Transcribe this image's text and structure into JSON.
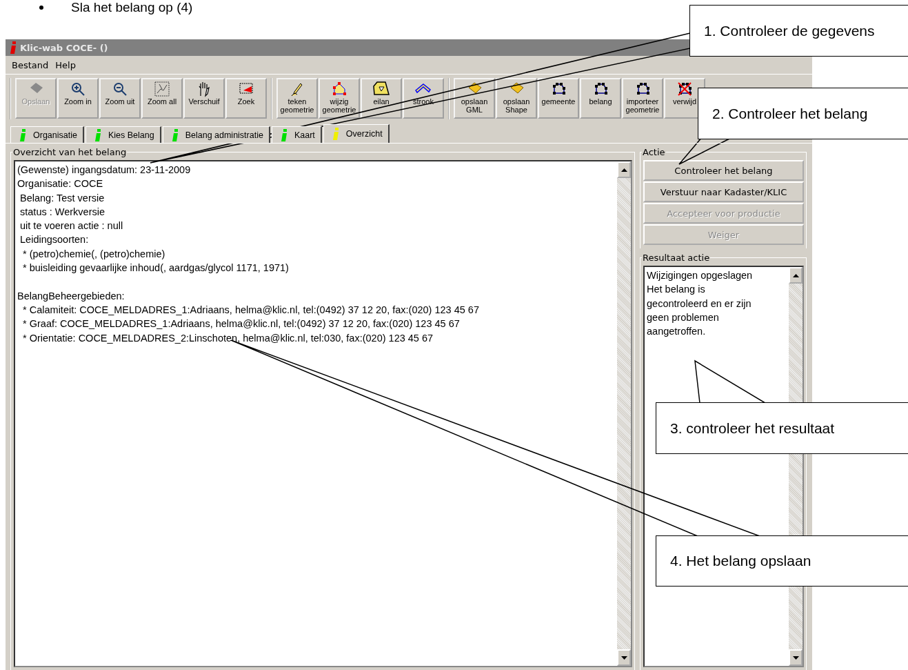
{
  "document": {
    "bullet": "Sla het belang op (4)"
  },
  "window": {
    "title": "Klic-wab COCE- ()"
  },
  "menu": [
    "Bestand",
    "Help"
  ],
  "toolbar_groups": [
    {
      "buttons": [
        {
          "lines": [
            "Opslaan"
          ],
          "disabled": true
        },
        {
          "lines": [
            "Zoom in"
          ],
          "disabled": false
        },
        {
          "lines": [
            "Zoom uit"
          ],
          "disabled": false
        },
        {
          "lines": [
            "Zoom all"
          ],
          "disabled": false
        },
        {
          "lines": [
            "Verschuif"
          ],
          "disabled": false
        },
        {
          "lines": [
            "Zoek"
          ],
          "disabled": false
        }
      ]
    },
    {
      "buttons": [
        {
          "lines": [
            "teken",
            "geometrie"
          ],
          "disabled": false
        },
        {
          "lines": [
            "wijzig",
            "geometrie"
          ],
          "disabled": false
        },
        {
          "lines": [
            "eilan"
          ],
          "disabled": false
        },
        {
          "lines": [
            "strook"
          ],
          "disabled": false
        }
      ]
    },
    {
      "buttons": [
        {
          "lines": [
            "opslaan",
            "GML"
          ],
          "disabled": false
        },
        {
          "lines": [
            "opslaan",
            "Shape"
          ],
          "disabled": false
        },
        {
          "lines": [
            "gemeente"
          ],
          "disabled": false
        },
        {
          "lines": [
            "belang"
          ],
          "disabled": false
        },
        {
          "lines": [
            "importeer",
            "geometrie"
          ],
          "disabled": false
        },
        {
          "lines": [
            "verwijd"
          ],
          "disabled": false
        }
      ]
    }
  ],
  "tabs": [
    {
      "label": "Organisatie",
      "selected": false
    },
    {
      "label": "Kies Belang",
      "selected": false
    },
    {
      "label": "Belang administratie",
      "selected": false
    },
    {
      "label": "Kaart",
      "selected": false
    },
    {
      "label": "Overzicht",
      "selected": true
    }
  ],
  "overview": {
    "title": "Overzicht van het belang",
    "paragraphs": [
      {
        "lines": [
          "(Gewenste) ingangsdatum: 23-11-2009",
          "Organisatie: COCE",
          " Belang: Test versie",
          " status : Werkversie",
          " uit te voeren actie : null",
          " Leidingsoorten:",
          "  * (petro)chemie(, (petro)chemie)",
          "  * buisleiding gevaarlijke inhoud(, aardgas/glycol 1171, 1971)"
        ]
      },
      {
        "lines": [
          "BelangBeheergebieden:",
          "  * Calamiteit: COCE_MELDADRES_1:Adriaans, helma@klic.nl, tel:(0492) 37 12 20, fax:(020) 123 45 67",
          "  * Graaf: COCE_MELDADRES_1:Adriaans, helma@klic.nl, tel:(0492) 37 12 20, fax:(020) 123 45 67",
          "  * Orientatie: COCE_MELDADRES_2:Linschoten, helma@klic.nl, tel:030, fax:(020) 123 45 67"
        ]
      }
    ]
  },
  "actions": {
    "title": "Actie",
    "buttons": [
      {
        "label": "Controleer het belang",
        "disabled": false
      },
      {
        "label": "Verstuur naar Kadaster/KLIC",
        "disabled": false
      },
      {
        "label": "Accepteer voor productie",
        "disabled": true
      },
      {
        "label": "Weiger",
        "disabled": true
      }
    ]
  },
  "result": {
    "title": "Resultaat actie",
    "lines": [
      "Wijzigingen opgeslagen",
      "Het belang is",
      "gecontroleerd en er zijn",
      "geen problemen",
      "aangetroffen."
    ]
  },
  "callouts": [
    {
      "text": "1. Controleer de gegevens"
    },
    {
      "text": "2. Controleer het belang"
    },
    {
      "text": "3. controleer het resultaat"
    },
    {
      "text": "4. Het belang opslaan"
    }
  ]
}
